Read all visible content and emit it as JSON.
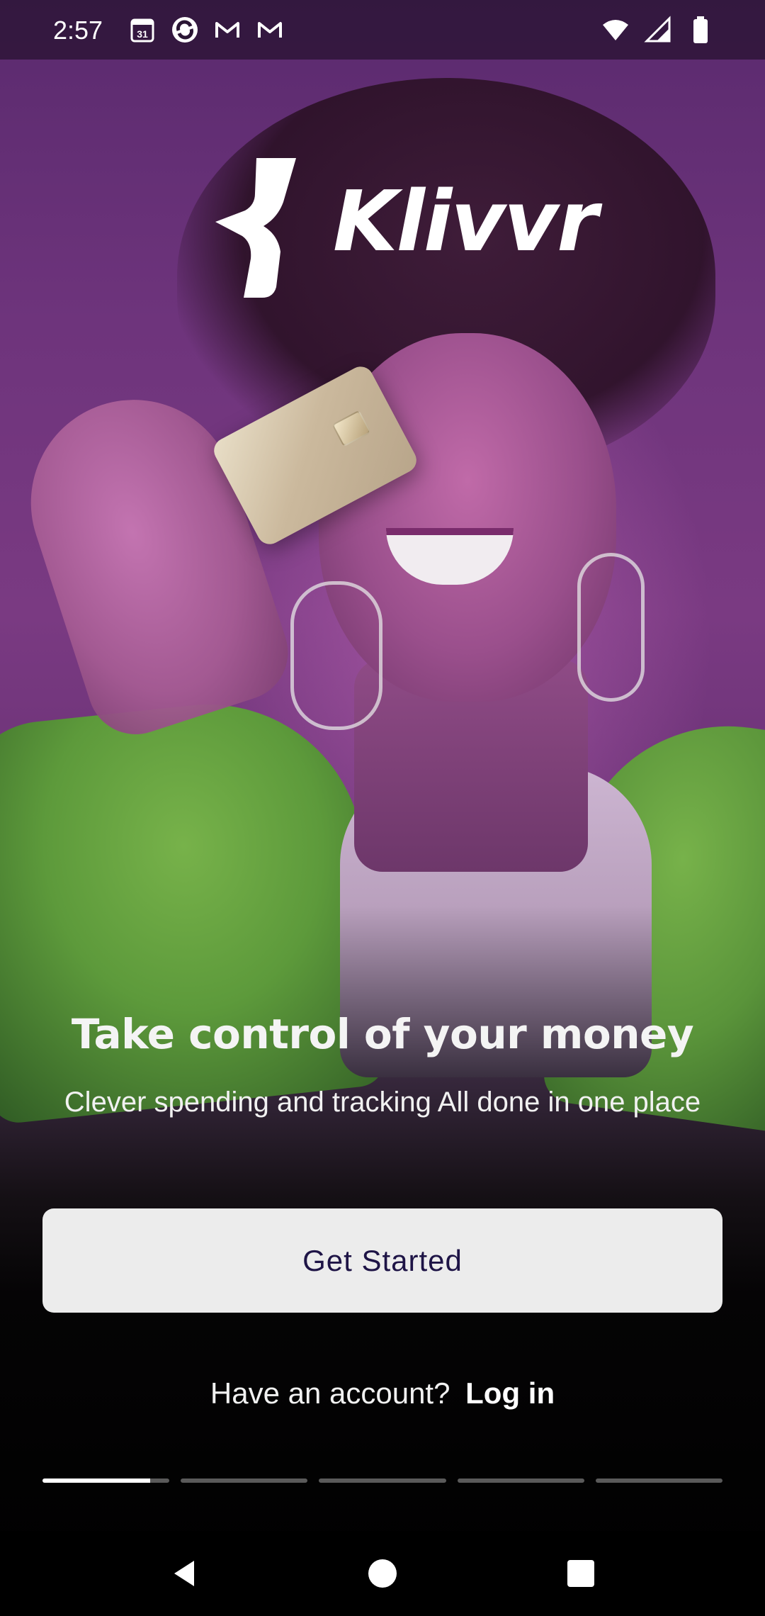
{
  "status_bar": {
    "time": "2:57",
    "left_icons": [
      "calendar-icon",
      "sync-icon",
      "gmail-icon",
      "gmail-icon"
    ],
    "right_icons": [
      "wifi-icon",
      "signal-icon",
      "battery-icon"
    ],
    "calendar_day": "31"
  },
  "brand": {
    "logo_text": "Klivvr"
  },
  "onboarding": {
    "headline": "Take control of your money",
    "subtext": "Clever spending and tracking All done in one place",
    "primary_button": "Get Started",
    "account_prompt": "Have an account?",
    "login_link": "Log in",
    "progress": {
      "total_steps": 5,
      "current_step": 1,
      "current_step_fill": 0.85
    }
  },
  "colors": {
    "background": "#000000",
    "button_bg": "#ECECEC",
    "button_text": "#1E1446",
    "text_primary": "#FFFFFF"
  },
  "nav_bar": {
    "buttons": [
      "back-icon",
      "home-icon",
      "recents-icon"
    ]
  }
}
